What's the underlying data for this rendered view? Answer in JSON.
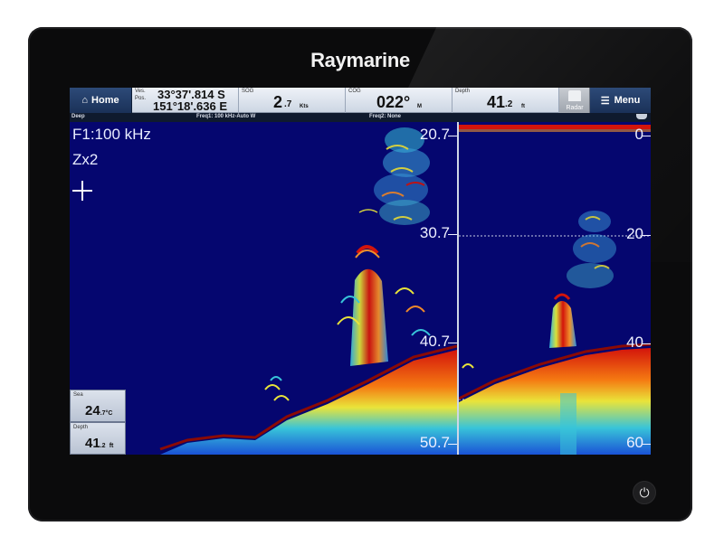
{
  "device": {
    "brand": "Raymarine",
    "power_icon": "power-icon"
  },
  "databar": {
    "home_label": "Home",
    "position": {
      "label_top": "Ves.",
      "label_bottom": "Pos.",
      "lat": "33°37'.814 S",
      "lon": "151°18'.636 E"
    },
    "sog": {
      "label": "SOG",
      "value": "2",
      "decimal": ".7",
      "unit": "Kts"
    },
    "cog": {
      "label": "COG",
      "value": "022°",
      "unit": "M"
    },
    "depth": {
      "label": "Depth",
      "value": "41",
      "decimal": ".2",
      "unit": "ft"
    },
    "radar_label": "Radar",
    "menu_label": "Menu"
  },
  "status": {
    "mode": "Deep",
    "freq1": "Freq1: 100 kHz-Auto W",
    "freq2": "Freq2: None"
  },
  "left_panel": {
    "freq": "F1:100 kHz",
    "zoom": "Zx2",
    "scale": [
      "20.7",
      "30.7",
      "40.7",
      "50.7"
    ],
    "sea_temp": {
      "label": "Sea",
      "value": "24",
      "decimal": ".7",
      "unit": "°C"
    },
    "depth_box": {
      "label": "Depth",
      "value": "41",
      "decimal": ".2",
      "unit": "ft"
    }
  },
  "right_panel": {
    "scale": [
      "0",
      "20",
      "40",
      "60"
    ]
  },
  "colors": {
    "water": "#05066f",
    "bottom_red": "#c8140c",
    "databar_blue": "#1a3158"
  }
}
